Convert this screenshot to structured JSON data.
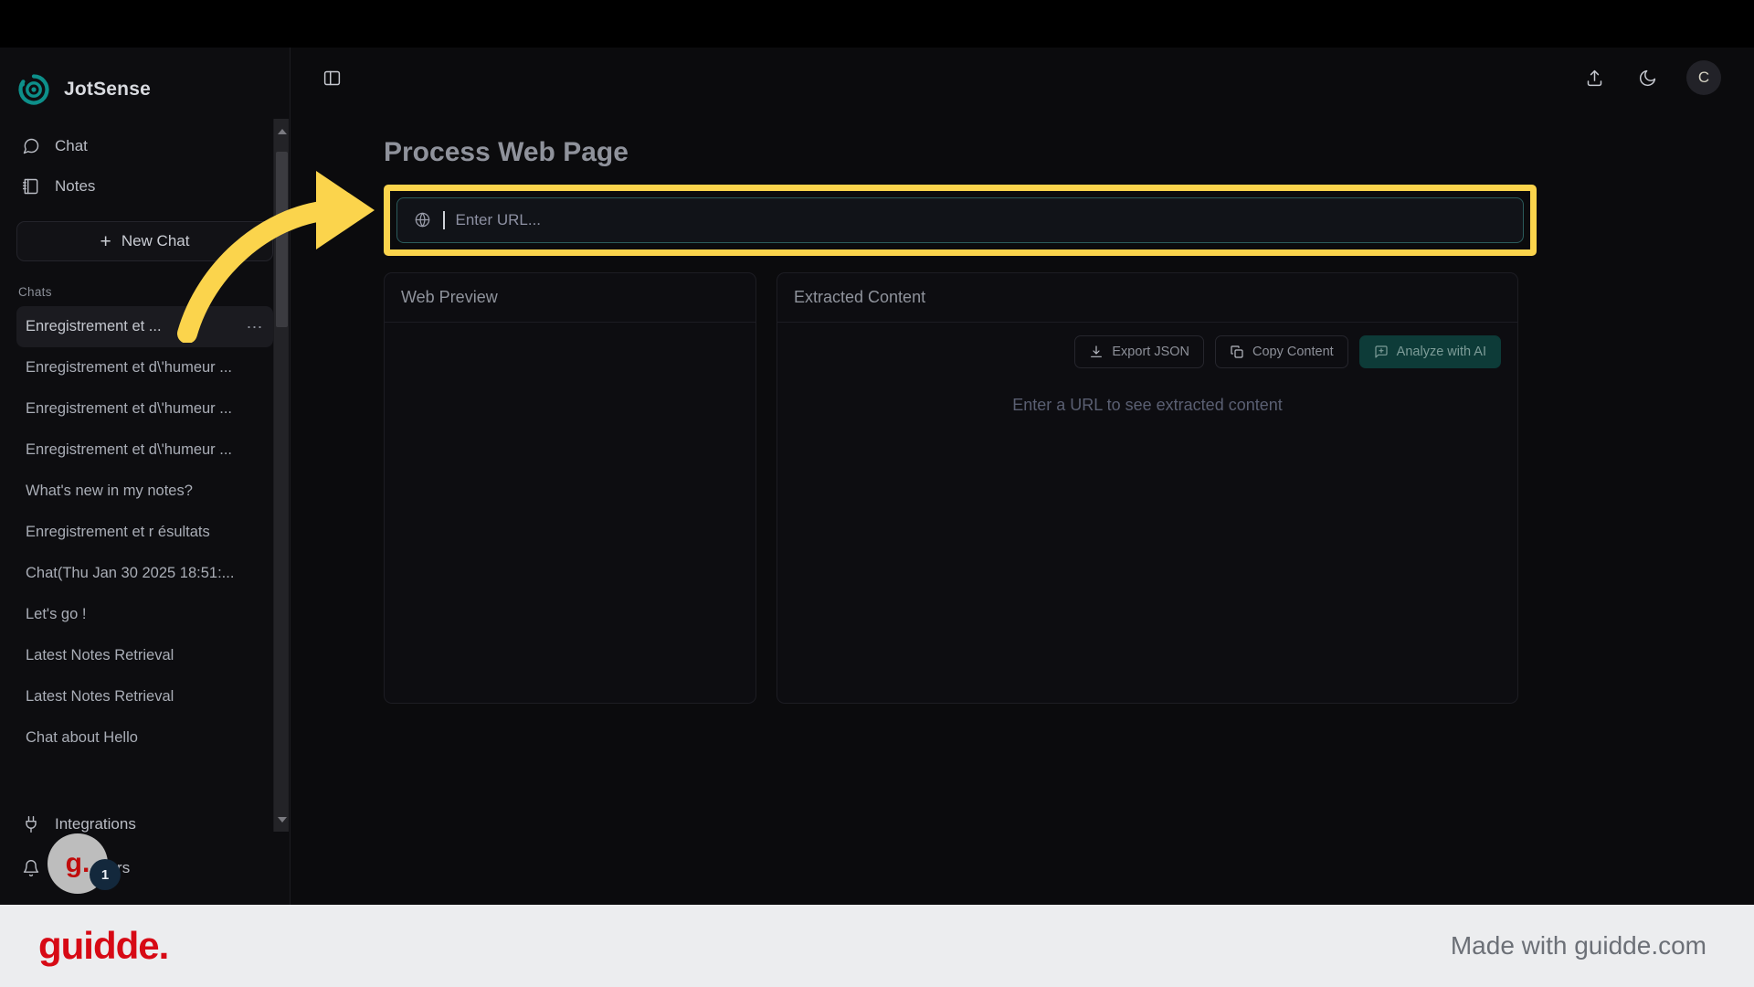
{
  "app": {
    "brand_name": "JotSense",
    "logo_icon": "jotsense-circle-logo",
    "accent_teal": "#0d8f8a",
    "highlight_yellow": "#FBD44C",
    "guidde_red": "#d70a15"
  },
  "sidebar": {
    "nav": [
      {
        "label": "Chat",
        "icon": "message-square-icon"
      },
      {
        "label": "Notes",
        "icon": "notebook-icon"
      }
    ],
    "new_chat_label": "New Chat",
    "new_chat_icon": "plus-icon",
    "chats_section_label": "Chats",
    "chat_menu_icon": "ellipsis-icon",
    "chats": [
      {
        "label": "Enregistrement et ...",
        "active": true
      },
      {
        "label": "Enregistrement et d\\'humeur ...",
        "active": false
      },
      {
        "label": "Enregistrement et d\\'humeur ...",
        "active": false
      },
      {
        "label": "Enregistrement et d\\'humeur ...",
        "active": false
      },
      {
        "label": "What's new in my notes?",
        "active": false
      },
      {
        "label": "Enregistrement et r ésultats",
        "active": false
      },
      {
        "label": "Chat(Thu Jan 30 2025 18:51:...",
        "active": false
      },
      {
        "label": "Let's go !",
        "active": false
      },
      {
        "label": "Latest Notes Retrieval",
        "active": false
      },
      {
        "label": "Latest Notes Retrieval",
        "active": false
      },
      {
        "label": "Chat about Hello",
        "active": false
      }
    ],
    "bottom": [
      {
        "label": "Integrations",
        "icon": "plug-icon"
      },
      {
        "label": "Reminders",
        "icon": "bell-icon"
      }
    ],
    "scrollbar": {
      "up_icon": "scroll-up-arrow-icon",
      "down_icon": "scroll-down-arrow-icon"
    }
  },
  "topbar": {
    "toggle_sidebar_icon": "panel-toggle-icon",
    "share_icon": "upload-share-icon",
    "theme_icon": "moon-icon",
    "avatar_initial": "C"
  },
  "main": {
    "page_title": "Process Web Page",
    "url_input": {
      "placeholder": "Enter URL...",
      "value": "",
      "icon": "globe-icon",
      "focused": true
    },
    "web_preview": {
      "title": "Web Preview"
    },
    "extracted_content": {
      "title": "Extracted Content",
      "buttons": [
        {
          "label": "Export JSON",
          "icon": "download-icon",
          "primary": false
        },
        {
          "label": "Copy Content",
          "icon": "copy-icon",
          "primary": false
        },
        {
          "label": "Analyze with AI",
          "icon": "message-square-plus-icon",
          "primary": true
        }
      ],
      "empty_message": "Enter a URL to see extracted content"
    }
  },
  "overlay": {
    "arrow_icon": "curved-pointer-arrow",
    "guidde_bubble_text": "g.",
    "guidde_badge_count": "1"
  },
  "footer": {
    "logo_text": "guidde.",
    "tagline": "Made with guidde.com"
  }
}
